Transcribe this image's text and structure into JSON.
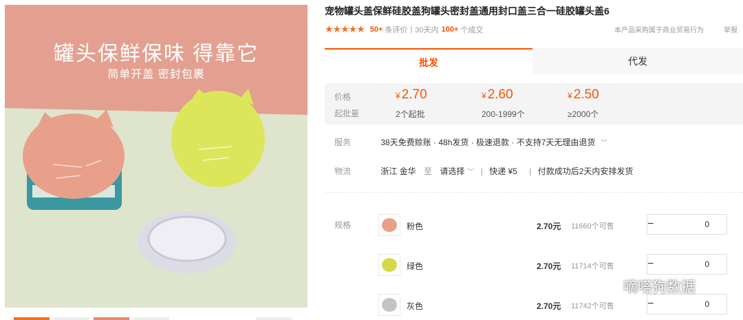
{
  "product": {
    "title": "宠物罐头盖保鲜硅胶盖狗罐头密封盖通用封口盖三合一硅胶罐头盖6",
    "image": {
      "headline": "罐头保鲜保味 得靠它",
      "subline": "简单开盖 密封包裹",
      "colors": {
        "background_top": "#e3a090",
        "background_bottom": "#dfe4cd",
        "pink_lid": "#e8a08a",
        "green_lid": "#dce65a",
        "gray_lid": "#dcdce6"
      }
    }
  },
  "rating": {
    "stars": "★★★★★",
    "review_count": "50+",
    "review_label": "条评价",
    "sep": "|",
    "deals_prefix": "30天内",
    "deals_count": "100+",
    "deals_label": "个成交"
  },
  "notice": "本产品采购属于商业贸易行为",
  "report_label": "举报",
  "tabs": [
    {
      "label": "批发",
      "active": true
    },
    {
      "label": "代发",
      "active": false
    }
  ],
  "pricing": {
    "price_label": "价格",
    "moq_label": "起批量",
    "currency": "¥",
    "tiers": [
      {
        "price": "2.70",
        "qty": "2个起批"
      },
      {
        "price": "2.60",
        "qty": "200-1999个"
      },
      {
        "price": "2.50",
        "qty": "≥2000个"
      }
    ]
  },
  "service": {
    "label": "服务",
    "text": "38天免费赊账 · 48h发货 · 极速退款 · 不支持7天无理由退货",
    "chevron": "﹀"
  },
  "logistics": {
    "label": "物流",
    "origin": "浙江 金华",
    "to": "至",
    "destination": "请选择",
    "sep": "|",
    "shipping": "快递 ¥5",
    "delivery": "付款成功后2天内安排发货"
  },
  "specs": {
    "label": "规格",
    "items": [
      {
        "name": "粉色",
        "price": "2.70元",
        "stock": "11660个可售",
        "qty": "0",
        "color": "#e8a08a"
      },
      {
        "name": "绿色",
        "price": "2.70元",
        "stock": "11714个可售",
        "qty": "0",
        "color": "#d4d84a"
      },
      {
        "name": "灰色",
        "price": "2.70元",
        "stock": "11742个可售",
        "qty": "0",
        "color": "#c4c4c4"
      }
    ],
    "minus": "−",
    "plus": "+"
  },
  "watermark": "嘀嗒狗数据",
  "icons": {
    "star": "star-icon",
    "chevron": "chevron-down-icon",
    "wechat": "wechat-icon",
    "minus": "minus-icon",
    "plus": "plus-icon"
  }
}
